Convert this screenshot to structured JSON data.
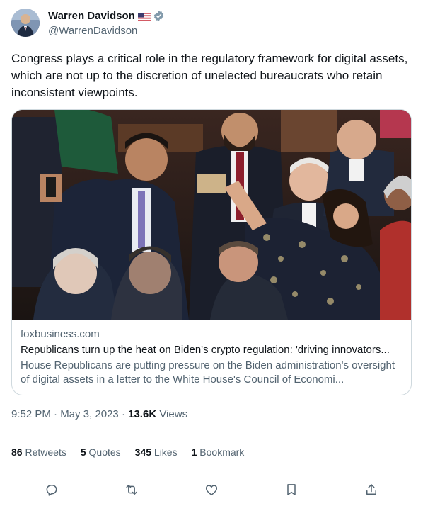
{
  "author": {
    "name": "Warren Davidson",
    "handle": "@WarrenDavidson",
    "flag_icon": "us-flag-icon",
    "verified_icon": "verified-badge-icon",
    "verified_color": "#829aab"
  },
  "tweet": {
    "text": "Congress plays a critical role in the regulatory framework for digital assets, which are not up to the discretion of unelected bureaucrats who retain inconsistent viewpoints."
  },
  "card": {
    "domain": "foxbusiness.com",
    "title": "Republicans turn up the heat on Biden's crypto regulation: 'driving innovators...",
    "description": "House Republicans are putting pressure on the Biden administration's oversight of digital assets in a letter to the White House's Council of Economi..."
  },
  "meta": {
    "time": "9:52 PM",
    "separator": " · ",
    "date": "May 3, 2023",
    "views_count": "13.6K",
    "views_label": "Views"
  },
  "stats": {
    "retweets_count": "86",
    "retweets_label": "Retweets",
    "quotes_count": "5",
    "quotes_label": "Quotes",
    "likes_count": "345",
    "likes_label": "Likes",
    "bookmarks_count": "1",
    "bookmarks_label": "Bookmark"
  },
  "actions": [
    "reply-icon",
    "retweet-icon",
    "like-icon",
    "bookmark-icon",
    "share-icon"
  ],
  "colors": {
    "text": "#0f1419",
    "secondary": "#536471",
    "border": "#cfd9de",
    "divider": "#eff3f4"
  }
}
